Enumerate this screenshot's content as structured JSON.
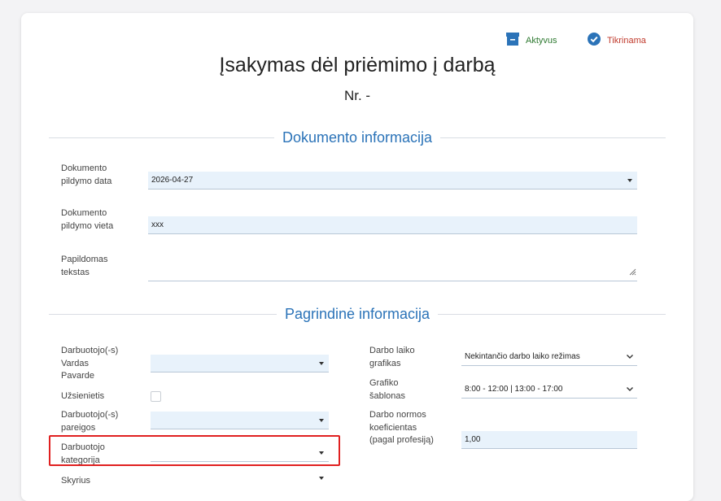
{
  "status": {
    "active_label": "Aktyvus",
    "checking_label": "Tikrinama",
    "active_color": "#2f7a32",
    "checking_color": "#c0392b"
  },
  "document": {
    "title": "Įsakymas dėl priėmimo į darbą",
    "number": "Nr. -"
  },
  "sections": {
    "doc_info": "Dokumento informacija",
    "main_info": "Pagrindinė informacija"
  },
  "doc_fields": {
    "date_label": "Dokumento pildymo data",
    "date_value": "2026-04-27",
    "place_label": "Dokumento pildymo vieta",
    "place_value": "xxx",
    "extra_label": "Papildomas tekstas",
    "extra_value": ""
  },
  "main_left": {
    "employee_name_label": "Darbuotojo(-s) Vardas Pavarde",
    "employee_name_value": "",
    "foreigner_label": "Užsienietis",
    "position_label": "Darbuotojo(-s) pareigos",
    "position_value": "",
    "category_label": "Darbuotojo kategorija",
    "category_value": "",
    "department_label": "Skyrius"
  },
  "main_right": {
    "schedule_label": "Darbo laiko grafikas",
    "schedule_value": "Nekintančio darbo laiko režimas",
    "template_label": "Grafiko šablonas",
    "template_value": "8:00 - 12:00 | 13:00 - 17:00",
    "norm_label": "Darbo normos koeficientas (pagal profesiją)",
    "norm_value": "1,00"
  },
  "colors": {
    "accent": "#2b73b8",
    "field_bg": "#e8f2fb",
    "highlight": "#e02020"
  }
}
